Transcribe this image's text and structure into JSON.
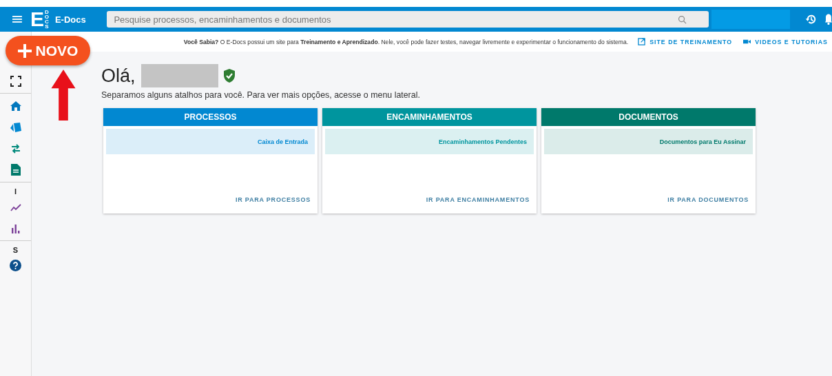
{
  "header": {
    "logo_letter": "E",
    "logo_vertical": "DOCS",
    "app_name": "E-Docs",
    "search": {
      "placeholder": "Pesquise processos, encaminhamentos e documentos"
    }
  },
  "new_button": {
    "label": "NOVO"
  },
  "sidebar": {
    "section_labels": [
      "I",
      "S"
    ]
  },
  "info_bar": {
    "text": "**Você Sabia?** O E-Docs possui um site para **Treinamento e Aprendizado**. Nele, você pode fazer testes, navegar livremente e experimentar o funcionamento do sistema.",
    "links": [
      "SITE DE TREINAMENTO",
      "VIDEOS E TUTORIAS"
    ]
  },
  "greeting": {
    "title": "Olá,",
    "subtitle": "Separamos alguns atalhos para você. Para ver mais opções, acesse o menu lateral."
  },
  "cards": [
    {
      "title": "PROCESSOS",
      "color": "#0288d1",
      "shortcut": "Caixa de Entrada",
      "link": "IR PARA PROCESSOS"
    },
    {
      "title": "ENCAMINHAMENTOS",
      "color": "#00959e",
      "shortcut": "Encaminhamentos Pendentes",
      "link": "IR PARA ENCAMINHAMENTOS"
    },
    {
      "title": "DOCUMENTOS",
      "color": "#00796b",
      "shortcut": "Documentos para Eu Assinar",
      "link": "IR PARA DOCUMENTOS"
    }
  ]
}
